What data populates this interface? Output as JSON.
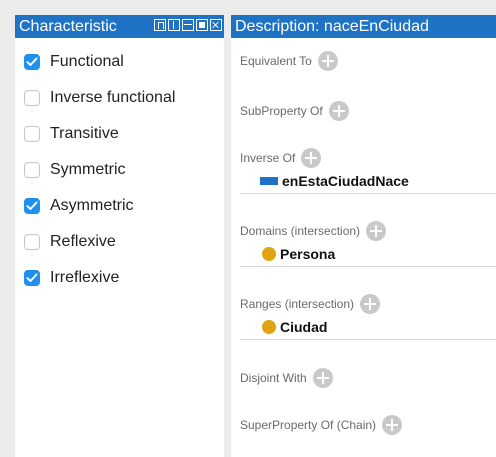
{
  "characteristics": {
    "title": "Characteristic",
    "items": [
      {
        "label": "Functional",
        "checked": true
      },
      {
        "label": "Inverse functional",
        "checked": false
      },
      {
        "label": "Transitive",
        "checked": false
      },
      {
        "label": "Symmetric",
        "checked": false
      },
      {
        "label": "Asymmetric",
        "checked": true
      },
      {
        "label": "Reflexive",
        "checked": false
      },
      {
        "label": "Irreflexive",
        "checked": true
      }
    ]
  },
  "description": {
    "title": "Description: naceEnCiudad",
    "equivalent_to": "Equivalent To",
    "subproperty_of": "SubProperty Of",
    "inverse_of": "Inverse Of",
    "inverse_value": "enEstaCiudadNace",
    "domains": "Domains (intersection)",
    "domain_value": "Persona",
    "ranges": "Ranges (intersection)",
    "range_value": "Ciudad",
    "disjoint_with": "Disjoint With",
    "superproperty_chain": "SuperProperty Of (Chain)"
  },
  "colors": {
    "title_bar": "#1e73c4",
    "checkbox": "#1f8ff0",
    "class_dot": "#e0a412",
    "property_mark": "#1e73c4"
  }
}
